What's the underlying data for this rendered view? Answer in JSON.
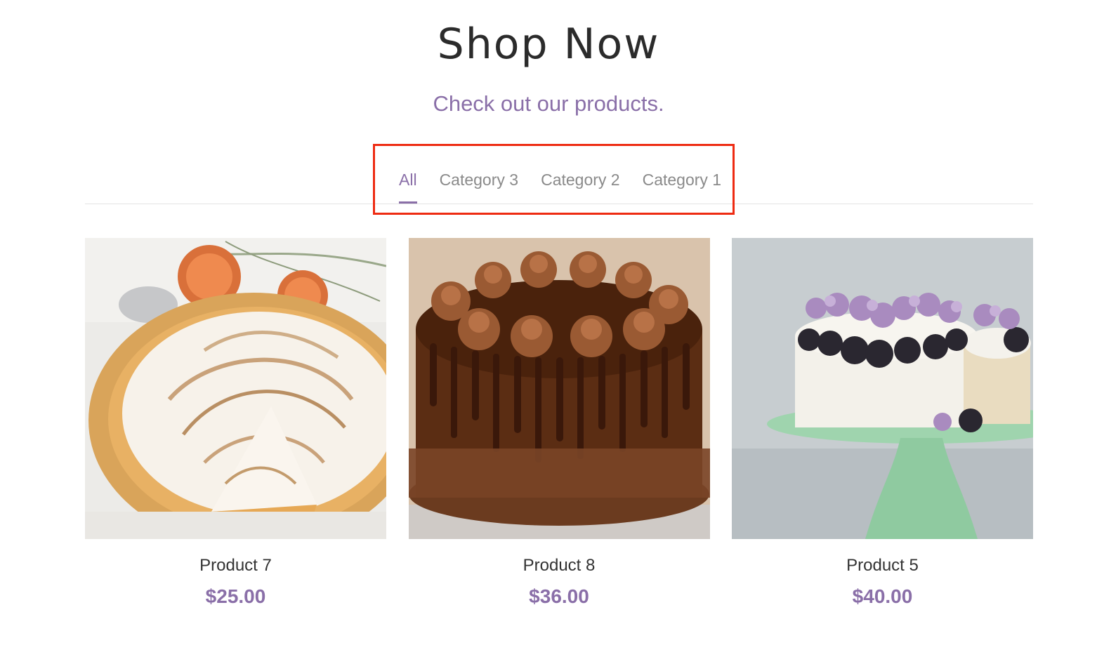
{
  "header": {
    "title": "Shop Now",
    "subtitle": "Check out our products."
  },
  "tabs": [
    {
      "label": "All",
      "active": true
    },
    {
      "label": "Category 3",
      "active": false
    },
    {
      "label": "Category 2",
      "active": false
    },
    {
      "label": "Category 1",
      "active": false
    }
  ],
  "products": [
    {
      "name": "Product 7",
      "price": "$25.00",
      "image": "meringue-tart"
    },
    {
      "name": "Product 8",
      "price": "$36.00",
      "image": "chocolate-drip-cake"
    },
    {
      "name": "Product 5",
      "price": "$40.00",
      "image": "blackberry-lilac-cake"
    }
  ],
  "colors": {
    "accent": "#8a6fa8",
    "highlight_box": "#ee2b12"
  }
}
